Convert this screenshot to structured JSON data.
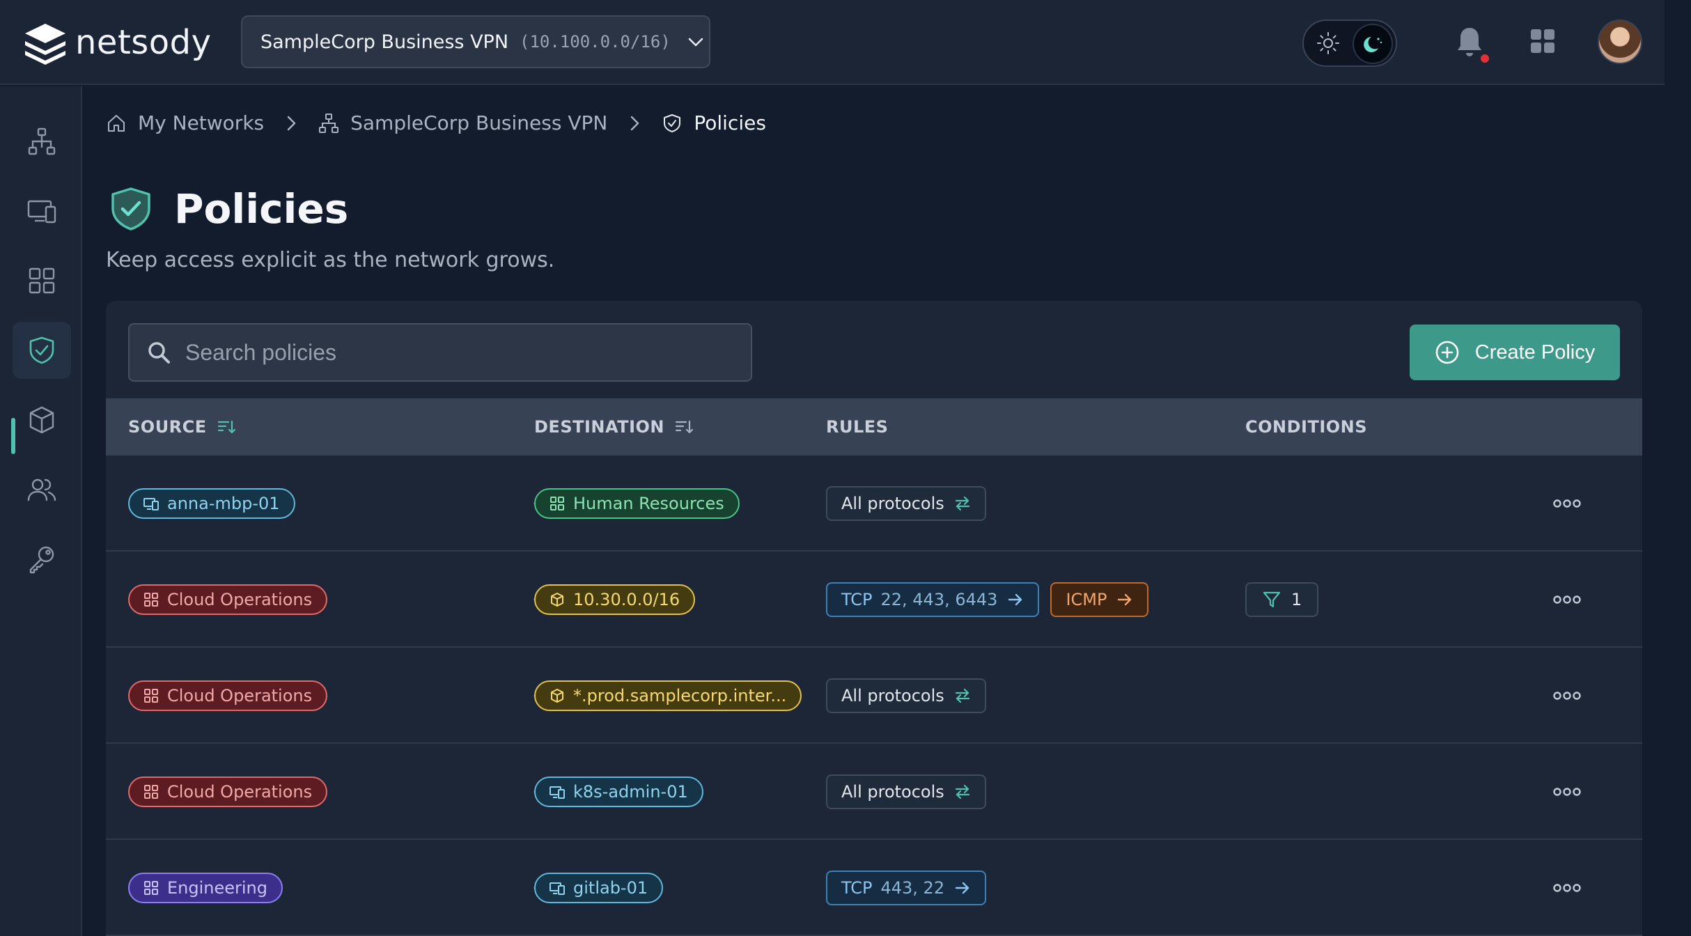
{
  "app": {
    "name": "netsody"
  },
  "network_selector": {
    "name": "SampleCorp Business VPN",
    "cidr": "(10.100.0.0/16)"
  },
  "breadcrumb": {
    "items": [
      {
        "label": "My Networks",
        "icon": "home-icon"
      },
      {
        "label": "SampleCorp Business VPN",
        "icon": "network-icon"
      },
      {
        "label": "Policies",
        "icon": "shield-check-icon"
      }
    ]
  },
  "page": {
    "title": "Policies",
    "subtitle": "Keep access explicit as the network grows."
  },
  "search": {
    "placeholder": "Search policies"
  },
  "create_button": {
    "label": "Create Policy"
  },
  "table": {
    "columns": {
      "source": "SOURCE",
      "destination": "DESTINATION",
      "rules": "RULES",
      "conditions": "CONDITIONS"
    },
    "rows": [
      {
        "source": {
          "label": "anna-mbp-01",
          "kind": "device"
        },
        "destination": {
          "label": "Human Resources",
          "kind": "group-green"
        },
        "rules": [
          {
            "type": "all",
            "label": "All protocols"
          }
        ],
        "conditions": null
      },
      {
        "source": {
          "label": "Cloud Operations",
          "kind": "group-red"
        },
        "destination": {
          "label": "10.30.0.0/16",
          "kind": "resource"
        },
        "rules": [
          {
            "type": "tcp",
            "label": "TCP",
            "ports": "22, 443, 6443"
          },
          {
            "type": "icmp",
            "label": "ICMP"
          }
        ],
        "conditions": {
          "count": "1"
        }
      },
      {
        "source": {
          "label": "Cloud Operations",
          "kind": "group-red"
        },
        "destination": {
          "label": "*.prod.samplecorp.inter...",
          "kind": "resource"
        },
        "rules": [
          {
            "type": "all",
            "label": "All protocols"
          }
        ],
        "conditions": null
      },
      {
        "source": {
          "label": "Cloud Operations",
          "kind": "group-red"
        },
        "destination": {
          "label": "k8s-admin-01",
          "kind": "device"
        },
        "rules": [
          {
            "type": "all",
            "label": "All protocols"
          }
        ],
        "conditions": null
      },
      {
        "source": {
          "label": "Engineering",
          "kind": "group-purple"
        },
        "destination": {
          "label": "gitlab-01",
          "kind": "device"
        },
        "rules": [
          {
            "type": "tcp",
            "label": "TCP",
            "ports": "443, 22"
          }
        ],
        "conditions": null
      }
    ]
  },
  "colors": {
    "accent": "#4fc1ad",
    "button": "#3d9a8a",
    "background": "#131c2c",
    "notification_dot": "#e03232"
  }
}
